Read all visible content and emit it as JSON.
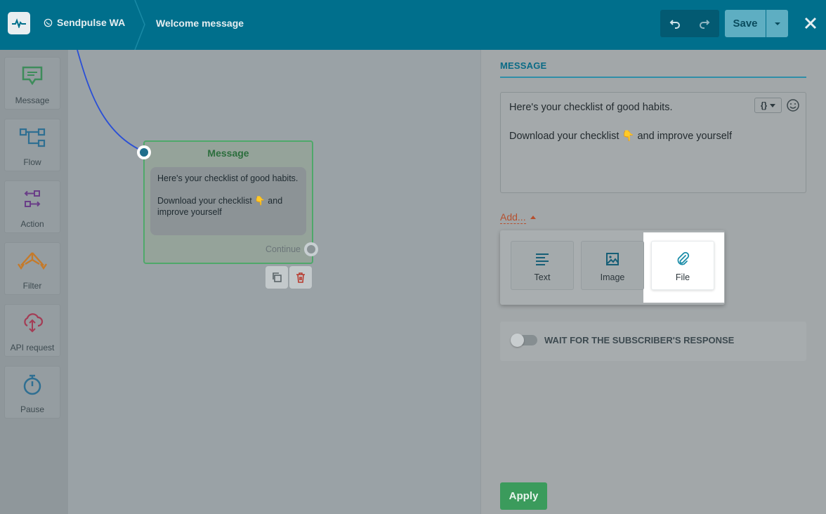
{
  "header": {
    "bot_name": "Sendpulse WA",
    "page_title": "Welcome message",
    "save_label": "Save"
  },
  "sidebar": {
    "items": [
      {
        "label": "Message",
        "icon": "message-icon"
      },
      {
        "label": "Flow",
        "icon": "flow-icon"
      },
      {
        "label": "Action",
        "icon": "action-icon"
      },
      {
        "label": "Filter",
        "icon": "filter-icon"
      },
      {
        "label": "API request",
        "icon": "api-request-icon"
      },
      {
        "label": "Pause",
        "icon": "pause-icon"
      }
    ]
  },
  "canvas": {
    "node": {
      "title": "Message",
      "line1": "Here's your checklist of good habits.",
      "line2": "Download your checklist 👇 and improve yourself",
      "continue_label": "Continue"
    }
  },
  "panel": {
    "tab_label": "MESSAGE",
    "message_line1": "Here's your checklist of good habits.",
    "message_line2": "Download your checklist 👇 and improve yourself",
    "variable_button": "{}",
    "add_label": "Add...",
    "add_options": [
      {
        "label": "Text",
        "icon": "text-lines-icon"
      },
      {
        "label": "Image",
        "icon": "image-icon"
      },
      {
        "label": "File",
        "icon": "paperclip-icon"
      }
    ],
    "wait_label": "WAIT FOR THE SUBSCRIBER'S RESPONSE",
    "wait_enabled": false,
    "apply_label": "Apply"
  },
  "colors": {
    "header_bg": "#006f8c",
    "accent": "#0b6b86",
    "apply_green": "#3b9b5c",
    "add_orange": "#b5502f"
  }
}
